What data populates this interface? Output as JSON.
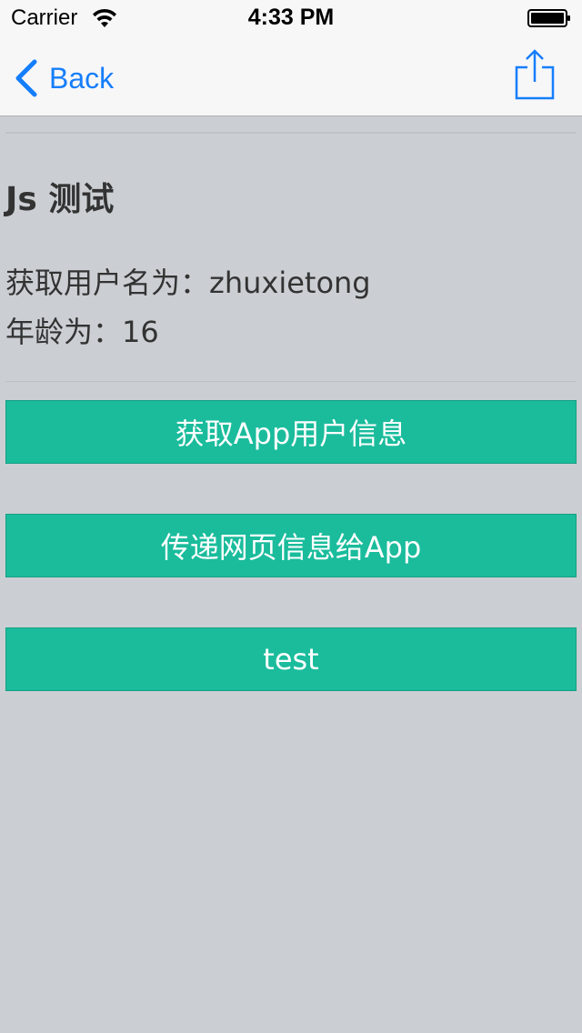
{
  "status_bar": {
    "carrier": "Carrier",
    "time": "4:33 PM"
  },
  "nav": {
    "back_label": "Back",
    "accent_color": "#157efb",
    "share_icon": "share-icon"
  },
  "page": {
    "heading": "Js 测试",
    "user_info": {
      "name_label": "获取用户名为：",
      "name_value": "zhuxietong",
      "age_label": "年龄为：",
      "age_value": "16"
    },
    "buttons": [
      {
        "label": "获取App用户信息"
      },
      {
        "label": "传递网页信息给App"
      },
      {
        "label": "test"
      }
    ],
    "button_color": "#1abc9c",
    "background_color": "#cbcfd3"
  }
}
